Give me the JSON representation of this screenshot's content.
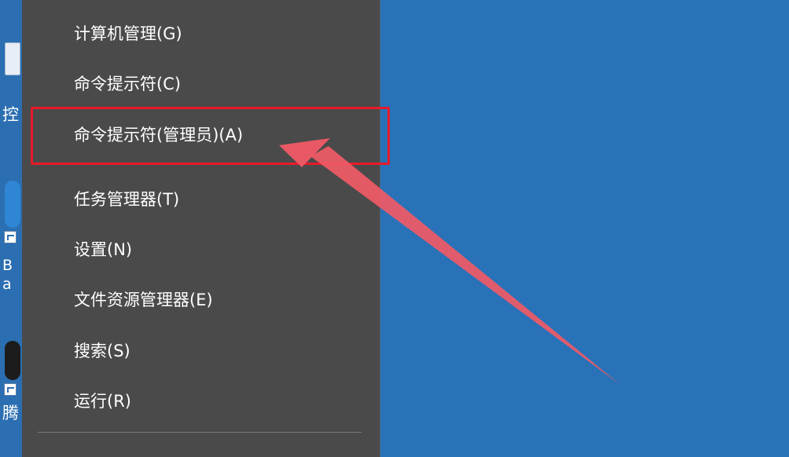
{
  "desktop": {
    "fragments": [
      "控",
      "B a",
      "腾"
    ]
  },
  "menu": {
    "items": [
      {
        "label": "计算机管理(G)"
      },
      {
        "label": "命令提示符(C)"
      },
      {
        "label": "命令提示符(管理员)(A)"
      },
      {
        "label": "任务管理器(T)"
      },
      {
        "label": "设置(N)"
      },
      {
        "label": "文件资源管理器(E)"
      },
      {
        "label": "搜索(S)"
      },
      {
        "label": "运行(R)"
      }
    ],
    "highlighted_index": 2
  },
  "colors": {
    "desktop_bg": "#2a72b8",
    "menu_bg": "#4a4a4a",
    "menu_text": "#ffffff",
    "highlight_border": "#e81a2a",
    "arrow": "#f05a66"
  },
  "annotation": {
    "type": "arrow",
    "points_to": "命令提示符(管理员)(A)"
  }
}
